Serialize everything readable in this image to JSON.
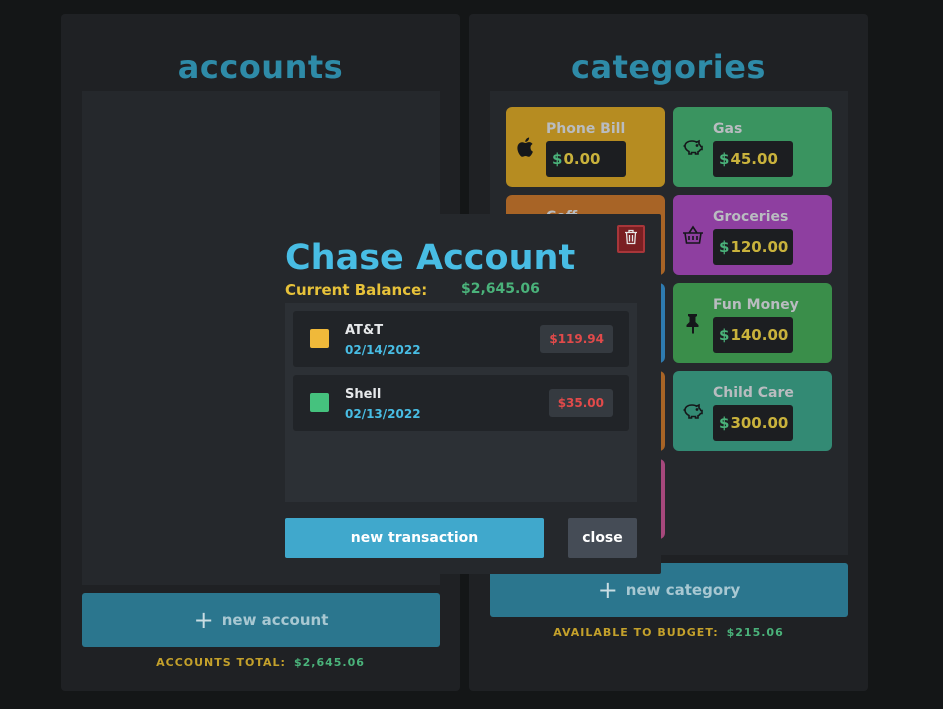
{
  "accounts": {
    "title": "accounts",
    "new_button_label": "new account",
    "total_label": "ACCOUNTS TOTAL:",
    "total_value": "$2,645.06"
  },
  "categories": {
    "title": "categories",
    "new_button_label": "new category",
    "budget_label": "AVAILABLE TO BUDGET:",
    "budget_value": "$215.06",
    "items": [
      {
        "name": "Phone Bill",
        "amount": "0.00",
        "color": "#b68c21",
        "icon": "apple-icon"
      },
      {
        "name": "Gas",
        "amount": "45.00",
        "color": "#3a9460",
        "icon": "piggy-bank-icon"
      },
      {
        "name": "Coff",
        "amount": "",
        "color": "#a86426",
        "icon": ""
      },
      {
        "name": "Groceries",
        "amount": "120.00",
        "color": "#8e3fa0",
        "icon": "basket-icon"
      },
      {
        "name": "",
        "amount": "",
        "color": "#2e7bb0",
        "icon": ""
      },
      {
        "name": "Fun Money",
        "amount": "140.00",
        "color": "#3a8e4a",
        "icon": "pushpin-icon"
      },
      {
        "name": "",
        "amount": "",
        "color": "#a86426",
        "icon": ""
      },
      {
        "name": "Child Care",
        "amount": "300.00",
        "color": "#338a74",
        "icon": "piggy-bank-icon"
      },
      {
        "name": "",
        "amount": "",
        "color": "#a6487c",
        "icon": ""
      }
    ]
  },
  "modal": {
    "title": "Chase Account",
    "balance_label": "Current Balance:",
    "balance_value": "$2,645.06",
    "transactions": [
      {
        "payee": "AT&T",
        "date": "02/14/2022",
        "amount": "$119.94",
        "color": "#f0b93a"
      },
      {
        "payee": "Shell",
        "date": "02/13/2022",
        "amount": "$35.00",
        "color": "#45c27e"
      }
    ],
    "new_transaction_label": "new transaction",
    "close_label": "close"
  }
}
